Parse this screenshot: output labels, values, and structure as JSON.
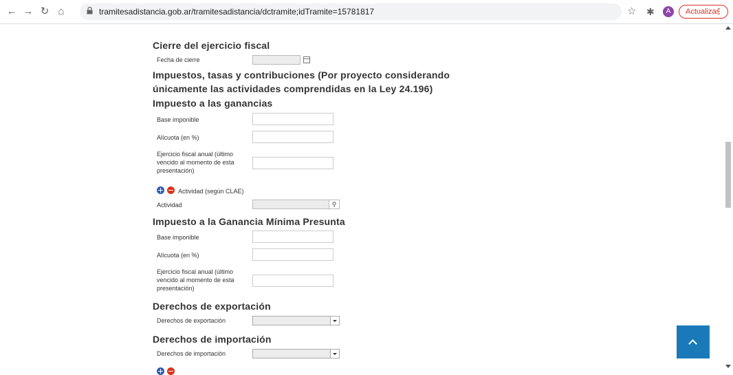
{
  "browser": {
    "url": "tramitesadistancia.gob.ar/tramitesadistancia/dctramite;idTramite=15781817",
    "profile_initial": "A",
    "update_label": "Actualizar",
    "menu_glyph": "⋮"
  },
  "form": {
    "cierre": {
      "title": "Cierre del ejercicio fiscal",
      "fecha_label": "Fecha de cierre",
      "fecha_value": ""
    },
    "impuestos_title_line1": "Impuestos, tasas y contribuciones (Por proyecto considerando",
    "impuestos_title_line2": "únicamente las actividades comprendidas en la Ley 24.196)",
    "ganancias": {
      "title": "Impuesto a las ganancias",
      "base_label": "Base imponible",
      "alicuota_label": "Alícuota (en %)",
      "ejercicio_label": "Ejercicio fiscal anual (último vencido al momento de esta presentación)",
      "actividad_list_label": "Actividad (según CLAE)",
      "actividad_label": "Actividad"
    },
    "minima": {
      "title": "Impuesto a la Ganancia Mínima Presunta",
      "base_label": "Base imponible",
      "alicuota_label": "Alícuota (en %)",
      "ejercicio_label": "Ejercicio fiscal anual (último vencido al momento de esta presentación)"
    },
    "exportacion": {
      "title": "Derechos de exportación",
      "label": "Derechos de exportación",
      "value": ""
    },
    "importacion": {
      "title": "Derechos de importación",
      "label": "Derechos de importación",
      "value": ""
    }
  }
}
